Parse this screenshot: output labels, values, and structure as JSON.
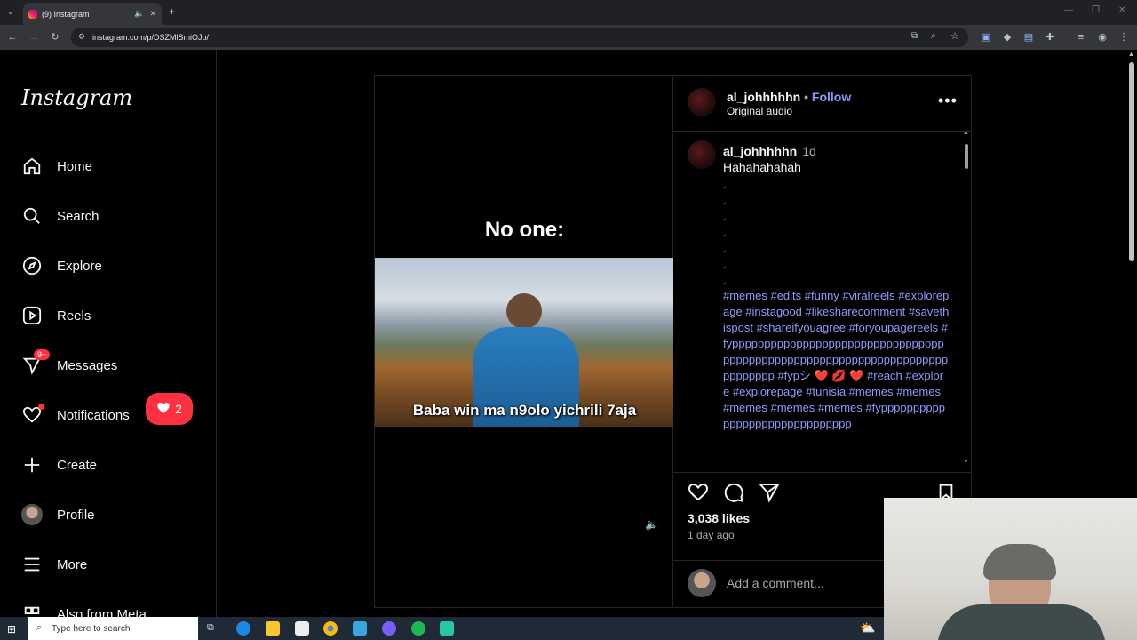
{
  "browser": {
    "tab_title": "(9) Instagram",
    "url": "instagram.com/p/DSZMlSmiOJp/"
  },
  "sidebar": {
    "logo": "Instagram",
    "items": [
      {
        "label": "Home",
        "icon": "home-icon"
      },
      {
        "label": "Search",
        "icon": "search-icon"
      },
      {
        "label": "Explore",
        "icon": "compass-icon"
      },
      {
        "label": "Reels",
        "icon": "reels-icon"
      },
      {
        "label": "Messages",
        "icon": "messenger-icon",
        "badge": "9+"
      },
      {
        "label": "Notifications",
        "icon": "heart-icon"
      },
      {
        "label": "Create",
        "icon": "plus-icon"
      },
      {
        "label": "Profile",
        "icon": "avatar"
      },
      {
        "label": "More",
        "icon": "menu-icon"
      },
      {
        "label": "Also from Meta",
        "icon": "meta-icon"
      }
    ],
    "notification_pill": "2"
  },
  "post": {
    "video_top_text": "No one:",
    "video_caption": "Baba win ma n9olo yichrili 7aja",
    "header": {
      "username": "al_johhhhhn",
      "separator": "•",
      "follow": "Follow",
      "audio": "Original audio"
    },
    "caption": {
      "username": "al_johhhhhn",
      "time": "1d",
      "text": "Hahahahahah",
      "dots": ".\n.\n.\n.\n.\n.\n.",
      "hashtags": "#memes #edits #funny #viralreels #explorepage #instagood #likesharecomment #savethispost #shareifyouagree #foryoupagereels #fypppppppppppppppppppppppppppppppppppppppppppppppppppppppppppppppppppppppppppp #fypシ ❤️ 💋 ❤️ #reach #explore #explorepage #tunisia #memes #memes #memes #memes #memes #fypppppppppppppppppppppppppppppp"
    },
    "likes": "3,038 likes",
    "age": "1 day ago",
    "comment_placeholder": "Add a comment..."
  },
  "taskbar": {
    "search_placeholder": "Type here to search"
  },
  "colors": {
    "link": "#8c9bf8",
    "badge": "#ff3040",
    "background": "#000000"
  }
}
